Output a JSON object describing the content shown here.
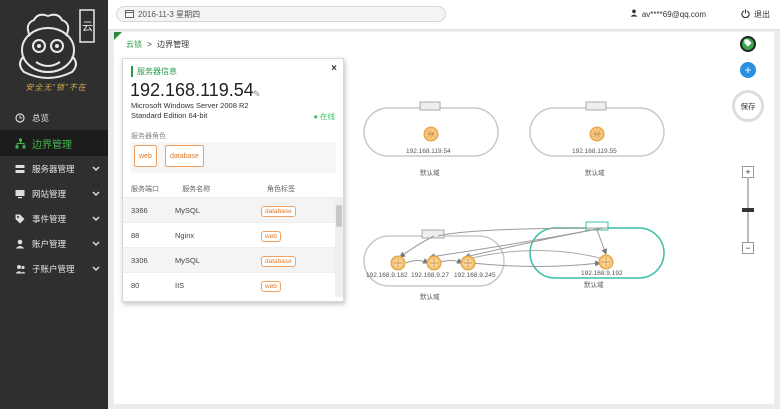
{
  "sidebar": {
    "logo_glyph": "云",
    "logo_text": "安全无“锁”不在",
    "items": [
      {
        "label": "总览",
        "icon": "clock-icon"
      },
      {
        "label": "边界管理",
        "icon": "sitemap-icon",
        "active": true
      },
      {
        "label": "服务器管理",
        "icon": "server-icon"
      },
      {
        "label": "网站管理",
        "icon": "monitor-icon"
      },
      {
        "label": "事件管理",
        "icon": "tag-icon"
      },
      {
        "label": "账户管理",
        "icon": "user-icon"
      },
      {
        "label": "子账户管理",
        "icon": "users-icon"
      }
    ]
  },
  "topbar": {
    "date": "2016-11-3 星期四",
    "user": "av****69@qq.com",
    "logout": "退出"
  },
  "breadcrumb": {
    "home": "云锁",
    "separator": ">",
    "current": "边界管理"
  },
  "server_card": {
    "title": "服务器信息",
    "close": "×",
    "ip": "192.168.119.54",
    "os": "Microsoft Windows Server 2008 R2 Standard Edition 64-bit",
    "status": "在线",
    "role_label": "服务器角色",
    "roles": [
      "web",
      "database"
    ],
    "columns": [
      "服务端口",
      "服务名称",
      "角色标签"
    ],
    "rows": [
      {
        "port": "3366",
        "name": "MySQL",
        "tag": "database"
      },
      {
        "port": "88",
        "name": "Nginx",
        "tag": "web"
      },
      {
        "port": "3306",
        "name": "MySQL",
        "tag": "database"
      },
      {
        "port": "80",
        "name": "IIS",
        "tag": "web"
      }
    ]
  },
  "topology": {
    "groups": [
      {
        "label": "默认域",
        "nodes": [
          "192.168.119.54"
        ]
      },
      {
        "label": "默认域",
        "nodes": [
          "192.168.119.55"
        ]
      },
      {
        "label": "默认域",
        "nodes": [
          "192.168.9.182",
          "192.168.9.27",
          "192.168.9.245"
        ]
      },
      {
        "label": "默认域",
        "nodes": [
          "192.168.9.192"
        ]
      }
    ]
  },
  "controls": {
    "save": "保存",
    "zoom_in": "+",
    "zoom_out": "−"
  },
  "colors": {
    "accent_green": "#2a9a4a",
    "teal": "#3cbfa8",
    "tag_orange": "#e07a2a",
    "blue": "#2a8fe0"
  }
}
